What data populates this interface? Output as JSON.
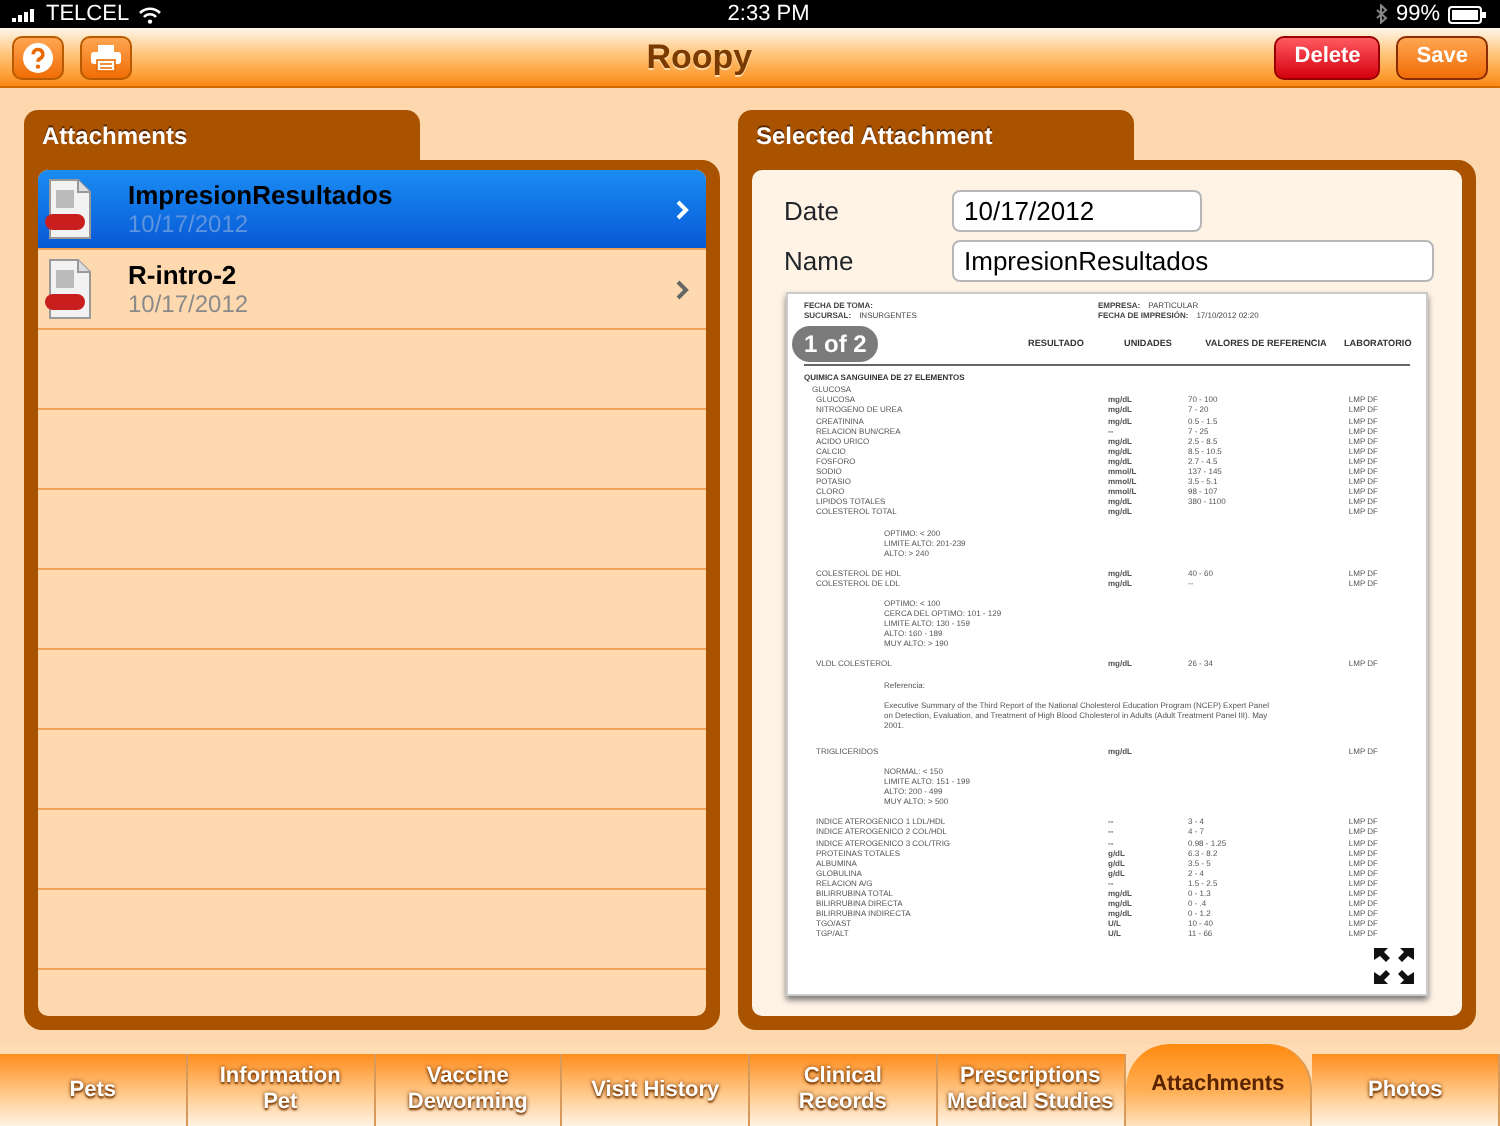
{
  "status_bar": {
    "carrier": "TELCEL",
    "time": "2:33 PM",
    "battery": "99%"
  },
  "toolbar": {
    "title": "Roopy",
    "buttons": [
      {
        "label": "Delete",
        "kind": "danger"
      },
      {
        "label": "Save",
        "kind": "save"
      }
    ]
  },
  "attachments_panel": {
    "title": "Attachments",
    "items": [
      {
        "name": "ImpresionResultados",
        "date": "10/17/2012",
        "selected": true
      },
      {
        "name": "R-intro-2",
        "date": "10/17/2012",
        "selected": false
      }
    ]
  },
  "selected_attachment": {
    "title": "Selected Attachment",
    "fields": [
      {
        "label": "Date",
        "value": "10/17/2012"
      },
      {
        "label": "Name",
        "value": "ImpresionResultados"
      }
    ],
    "preview": {
      "page_indicator": "1 of 2",
      "header_left": [
        {
          "label": "FECHA DE TOMA:"
        },
        {
          "label": "SUCURSAL:",
          "value": "INSURGENTES"
        }
      ],
      "header_right": [
        {
          "label": "EMPRESA:",
          "value": "PARTICULAR"
        },
        {
          "label": "FECHA DE IMPRESIÓN:",
          "value": "17/10/2012 02:20"
        }
      ],
      "columns": [
        "RESULTADO",
        "UNIDADES",
        "VALORES DE REFERENCIA",
        "LABORATORIO"
      ],
      "section": "QUIMICA SANGUINEA DE 27 ELEMENTOS",
      "group": "GLUCOSA",
      "rows": [
        {
          "kind": "test",
          "name": "GLUCOSA",
          "unit": "mg/dL",
          "reference": "70 - 100",
          "lab": "LMP DF"
        },
        {
          "kind": "test",
          "name": "NITROGENO DE UREA",
          "unit": "mg/dL",
          "reference": "7 - 20",
          "lab": "LMP DF"
        },
        {
          "kind": "test",
          "name": "CREATININA",
          "unit": "mg/dL",
          "reference": "0.5 - 1.5",
          "lab": "LMP DF"
        },
        {
          "kind": "test",
          "name": "RELACION BUN/CREA",
          "unit": "--",
          "reference": "7 - 25",
          "lab": "LMP DF"
        },
        {
          "kind": "test",
          "name": "ACIDO URICO",
          "unit": "mg/dL",
          "reference": "2.5 - 8.5",
          "lab": "LMP DF"
        },
        {
          "kind": "test",
          "name": "CALCIO",
          "unit": "mg/dL",
          "reference": "8.5 - 10.5",
          "lab": "LMP DF"
        },
        {
          "kind": "test",
          "name": "FOSFORO",
          "unit": "mg/dL",
          "reference": "2.7 - 4.5",
          "lab": "LMP DF"
        },
        {
          "kind": "test",
          "name": "SODIO",
          "unit": "mmol/L",
          "reference": "137 - 145",
          "lab": "LMP DF"
        },
        {
          "kind": "test",
          "name": "POTASIO",
          "unit": "mmol/L",
          "reference": "3.5 - 5.1",
          "lab": "LMP DF"
        },
        {
          "kind": "test",
          "name": "CLORO",
          "unit": "mmol/L",
          "reference": "98 - 107",
          "lab": "LMP DF"
        },
        {
          "kind": "test",
          "name": "LIPIDOS TOTALES",
          "unit": "mg/dL",
          "reference": "380 - 1100",
          "lab": "LMP DF"
        },
        {
          "kind": "test",
          "name": "COLESTEROL TOTAL",
          "unit": "mg/dL",
          "lab": "LMP DF"
        },
        {
          "kind": "note",
          "lines": [
            "OPTIMO: < 200",
            "LIMITE ALTO: 201-239",
            "ALTO: > 240"
          ]
        },
        {
          "kind": "test",
          "name": "COLESTEROL DE HDL",
          "unit": "mg/dL",
          "reference": "40 - 60",
          "lab": "LMP DF"
        },
        {
          "kind": "test",
          "name": "COLESTEROL DE LDL",
          "unit": "mg/dL",
          "reference": "--",
          "lab": "LMP DF"
        },
        {
          "kind": "note",
          "lines": [
            "OPTIMO: < 100",
            "CERCA DEL OPTIMO: 101 - 129",
            "LIMITE ALTO: 130 - 159",
            "ALTO: 160 - 189",
            "MUY ALTO: > 190"
          ]
        },
        {
          "kind": "test",
          "name": "VLDL COLESTEROL",
          "unit": "mg/dL",
          "reference": "26 - 34",
          "lab": "LMP DF"
        },
        {
          "kind": "note",
          "lines": [
            "Referencia:"
          ]
        },
        {
          "kind": "paragraph",
          "text": "Executive Summary of the Third Report of the National Cholesterol Education Program (NCEP) Expert Panel on Detection, Evaluation, and Treatment of High Blood Cholesterol in Adults (Adult Treatment Panel III). May 2001."
        },
        {
          "kind": "test",
          "name": "TRIGLICERIDOS",
          "unit": "mg/dL",
          "lab": "LMP DF"
        },
        {
          "kind": "note",
          "lines": [
            "NORMAL: < 150",
            "LIMITE ALTO: 151 - 199",
            "ALTO: 200 - 499",
            "MUY ALTO: > 500"
          ]
        },
        {
          "kind": "test",
          "name": "INDICE ATEROGENICO 1 LDL/HDL",
          "unit": "--",
          "reference": "3 - 4",
          "lab": "LMP DF"
        },
        {
          "kind": "test",
          "name": "INDICE ATEROGENICO 2 COL/HDL",
          "unit": "--",
          "reference": "4 - 7",
          "lab": "LMP DF"
        },
        {
          "kind": "test",
          "name": "INDICE ATEROGENICO 3 COL/TRIG",
          "unit": "--",
          "reference": "0.98 - 1.25",
          "lab": "LMP DF"
        },
        {
          "kind": "test",
          "name": "PROTEINAS TOTALES",
          "unit": "g/dL",
          "reference": "6.3 - 8.2",
          "lab": "LMP DF"
        },
        {
          "kind": "test",
          "name": "ALBUMINA",
          "unit": "g/dL",
          "reference": "3.5 - 5",
          "lab": "LMP DF"
        },
        {
          "kind": "test",
          "name": "GLOBULINA",
          "unit": "g/dL",
          "reference": "2 - 4",
          "lab": "LMP DF"
        },
        {
          "kind": "test",
          "name": "RELACION A/G",
          "unit": "--",
          "reference": "1.5 - 2.5",
          "lab": "LMP DF"
        },
        {
          "kind": "test",
          "name": "BILIRRUBINA TOTAL",
          "unit": "mg/dL",
          "reference": "0 - 1.3",
          "lab": "LMP DF"
        },
        {
          "kind": "test",
          "name": "BILIRRUBINA DIRECTA",
          "unit": "mg/dL",
          "reference": "0 - .4",
          "lab": "LMP DF"
        },
        {
          "kind": "test",
          "name": "BILIRRUBINA INDIRECTA",
          "unit": "mg/dL",
          "reference": "0 - 1.2",
          "lab": "LMP DF"
        },
        {
          "kind": "test",
          "name": "TGO/AST",
          "unit": "U/L",
          "reference": "10 - 40",
          "lab": "LMP DF"
        },
        {
          "kind": "test",
          "name": "TGP/ALT",
          "unit": "U/L",
          "reference": "11 - 66",
          "lab": "LMP DF"
        }
      ]
    }
  },
  "tabs": [
    {
      "label": "Pets",
      "selected": false
    },
    {
      "label": "Information\nPet",
      "selected": false
    },
    {
      "label": "Vaccine\nDeworming",
      "selected": false
    },
    {
      "label": "Visit History",
      "selected": false
    },
    {
      "label": "Clinical\nRecords",
      "selected": false
    },
    {
      "label": "Prescriptions\nMedical Studies",
      "selected": false
    },
    {
      "label": "Attachments",
      "selected": true
    },
    {
      "label": "Photos",
      "selected": false
    }
  ]
}
